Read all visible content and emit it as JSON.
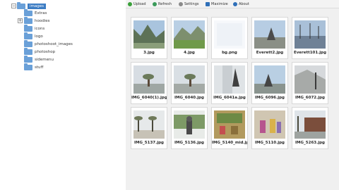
{
  "tree": {
    "items": [
      {
        "label": "images",
        "selected": true,
        "expanded": true
      },
      {
        "label": "Extras"
      },
      {
        "label": "hoodies",
        "expandable": true
      },
      {
        "label": "icons"
      },
      {
        "label": "logo"
      },
      {
        "label": "photoshoot_images"
      },
      {
        "label": "photoshop"
      },
      {
        "label": "sidemenu"
      },
      {
        "label": "stuff"
      }
    ]
  },
  "toolbar": {
    "upload": "Upload",
    "refresh": "Refresh",
    "settings": "Settings",
    "maximize": "Maximize",
    "about": "About"
  },
  "files": [
    {
      "name": "3.jpg"
    },
    {
      "name": "4.jpg"
    },
    {
      "name": "bg.png"
    },
    {
      "name": "Everett2.jpg"
    },
    {
      "name": "Everett101.jpg"
    },
    {
      "name": "IMG_6040(1).jpg"
    },
    {
      "name": "IMG_6040.jpg"
    },
    {
      "name": "IMG_6041a.jpg"
    },
    {
      "name": "IMG_6096.jpg"
    },
    {
      "name": "IMG_6072.jpg"
    },
    {
      "name": "IMG_5137.jpg"
    },
    {
      "name": "IMG_5136.jpg"
    },
    {
      "name": "IMG_5140_mid.jpg"
    },
    {
      "name": "IMG_5110.jpg"
    },
    {
      "name": "IMG_5263.jpg"
    }
  ],
  "colors": {
    "accent": "#3d7dc4",
    "folder": "#6aa0d8",
    "upload_icon": "#3aa03a",
    "refresh_icon": "#3a9a5a",
    "settings_icon": "#8a8a8a",
    "maximize_icon": "#2f6fb8",
    "about_icon": "#2f6fb8"
  }
}
